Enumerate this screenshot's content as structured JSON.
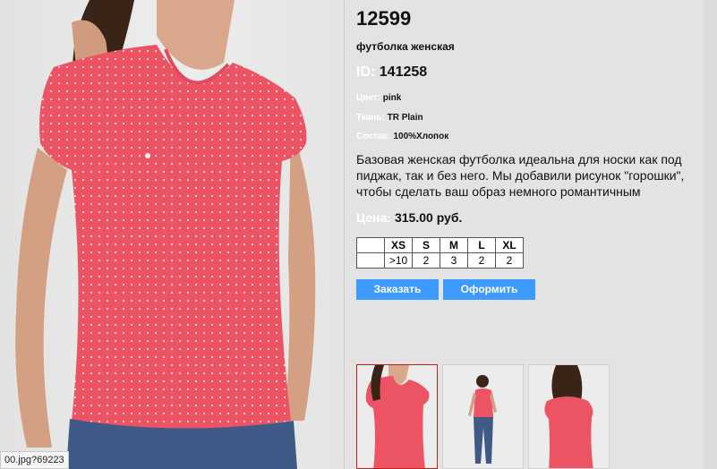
{
  "product": {
    "sku": "12599",
    "subtitle": "футболка женская",
    "id_label": "ID:",
    "id_value": "141258",
    "attributes": [
      {
        "label": "Цвет:",
        "value": "pink"
      },
      {
        "label": "Ткань:",
        "value": "TR Plain"
      },
      {
        "label": "Состав:",
        "value": "100%Хлопок"
      }
    ],
    "description": "Базовая женская футболка идеальна для носки как под пиджак, так и без него. Мы добавили рисунок \"горошки\", чтобы сделать ваш образ немного романтичным",
    "price_label": "Цена:",
    "price_value": "315.00 руб."
  },
  "sizes": {
    "headers": [
      "",
      "XS",
      "S",
      "M",
      "L",
      "XL"
    ],
    "stock": [
      "",
      ">10",
      "2",
      "3",
      "2",
      "2"
    ]
  },
  "buttons": {
    "order": "Заказать",
    "checkout": "Оформить"
  },
  "status_bar": "00.jpg?69223",
  "colors": {
    "accent": "#3d9bff",
    "shirt": "#ec5464",
    "active_thumb_border": "#c61b1b"
  },
  "thumbnails": [
    {
      "icon": "front-closeup-photo",
      "active": true
    },
    {
      "icon": "full-body-front-photo",
      "active": false
    },
    {
      "icon": "back-view-photo",
      "active": false
    }
  ]
}
